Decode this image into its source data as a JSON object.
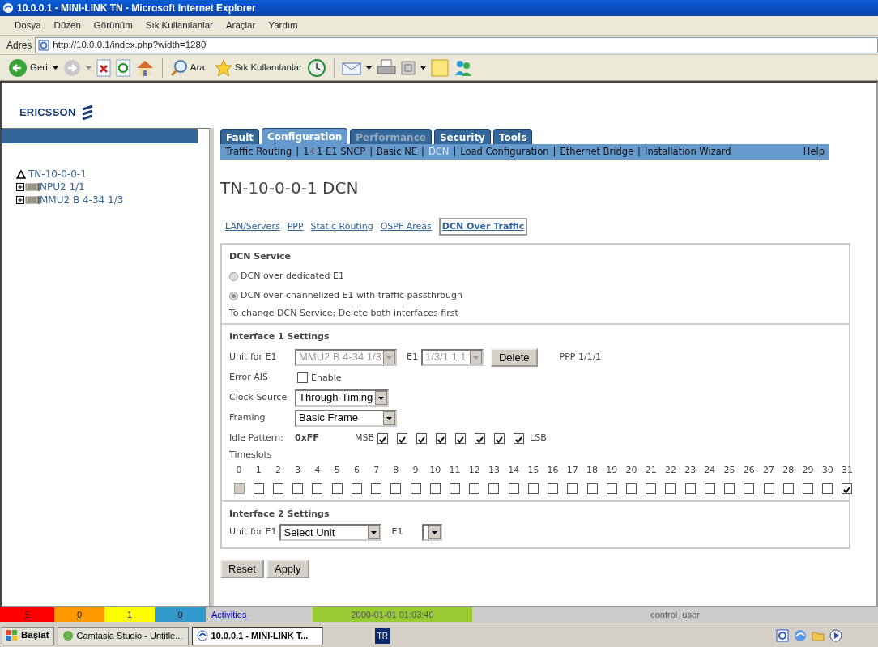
{
  "window": {
    "title": "10.0.0.1 - MINI-LINK TN - Microsoft Internet Explorer"
  },
  "menu_bar": [
    "Dosya",
    "Düzen",
    "Görünüm",
    "Sık Kullanılanlar",
    "Araçlar",
    "Yardım"
  ],
  "address_bar": {
    "label": "Adres",
    "url": "http://10.0.0.1/index.php?width=1280"
  },
  "toolbar": {
    "back_label": "Geri",
    "search_label": "Ara",
    "favorites_label": "Sık Kullanılanlar"
  },
  "logo": {
    "text": "ERICSSON"
  },
  "tree": {
    "label": "TN-10-0-0-1",
    "children": [
      {
        "label": "NPU2 1/1",
        "expanded": false
      },
      {
        "label": "MMU2 B 4-34 1/3",
        "expanded": false
      }
    ]
  },
  "tabs": [
    {
      "label": "Fault",
      "selected": false,
      "disabled": false
    },
    {
      "label": "Configuration",
      "selected": true,
      "disabled": false
    },
    {
      "label": "Performance",
      "selected": false,
      "disabled": true
    },
    {
      "label": "Security",
      "selected": false,
      "disabled": false
    },
    {
      "label": "Tools",
      "selected": false,
      "disabled": false
    }
  ],
  "subnav": {
    "items": [
      {
        "label": "Traffic Routing",
        "selected": false
      },
      {
        "label": "1+1 E1 SNCP",
        "selected": false
      },
      {
        "label": "Basic NE",
        "selected": false
      },
      {
        "label": "DCN",
        "selected": true
      },
      {
        "label": "Load Configuration",
        "selected": false
      },
      {
        "label": "Ethernet Bridge",
        "selected": false
      },
      {
        "label": "Installation Wizard",
        "selected": false
      }
    ],
    "separator": "|",
    "help": "Help"
  },
  "heading": "TN-10-0-0-1 DCN",
  "subtabs": [
    {
      "label": "LAN/Servers",
      "selected": false
    },
    {
      "label": "PPP",
      "selected": false
    },
    {
      "label": "Static Routing",
      "selected": false
    },
    {
      "label": "OSPF Areas",
      "selected": false
    },
    {
      "label": "DCN Over Traffic",
      "selected": true
    }
  ],
  "dcn_service": {
    "title": "DCN Service",
    "options": [
      {
        "label": "DCN over dedicated E1",
        "selected": false,
        "disabled": true
      },
      {
        "label": "DCN over channelized E1 with traffic passthrough",
        "selected": true,
        "disabled": true
      }
    ],
    "note": "To change DCN Service: Delete both interfaces first"
  },
  "interface_1": {
    "title": "Interface 1 Settings",
    "unit_label": "Unit for E1",
    "unit_value": "MMU2 B 4-34 1/3",
    "unit_disabled": true,
    "e1_label": "E1",
    "e1_value": "1/3/1 1.1",
    "e1_disabled": true,
    "delete_button": "Delete",
    "ppp": "PPP 1/1/1",
    "error_ais_label": "Error AIS",
    "error_ais": {
      "label": "Enable",
      "checked": false
    },
    "clock_label": "Clock Source",
    "clock_value": "Through-Timing",
    "framing_label": "Framing",
    "framing_value": "Basic Frame",
    "idle_label": "Idle Pattern:",
    "idle_value": "0xFF",
    "msb": "MSB",
    "lsb": "LSB",
    "idle_bits": [
      {
        "checked": true
      },
      {
        "checked": true
      },
      {
        "checked": true
      },
      {
        "checked": true
      },
      {
        "checked": true
      },
      {
        "checked": true
      },
      {
        "checked": true
      },
      {
        "checked": true
      }
    ],
    "timeslots_label": "Timeslots",
    "timeslots": [
      {
        "number": "0",
        "checked": false,
        "disabled": true
      },
      {
        "number": "1",
        "checked": false,
        "disabled": false
      },
      {
        "number": "2",
        "checked": false,
        "disabled": false
      },
      {
        "number": "3",
        "checked": false,
        "disabled": false
      },
      {
        "number": "4",
        "checked": false,
        "disabled": false
      },
      {
        "number": "5",
        "checked": false,
        "disabled": false
      },
      {
        "number": "6",
        "checked": false,
        "disabled": false
      },
      {
        "number": "7",
        "checked": false,
        "disabled": false
      },
      {
        "number": "8",
        "checked": false,
        "disabled": false
      },
      {
        "number": "9",
        "checked": false,
        "disabled": false
      },
      {
        "number": "10",
        "checked": false,
        "disabled": false
      },
      {
        "number": "11",
        "checked": false,
        "disabled": false
      },
      {
        "number": "12",
        "checked": false,
        "disabled": false
      },
      {
        "number": "13",
        "checked": false,
        "disabled": false
      },
      {
        "number": "14",
        "checked": false,
        "disabled": false
      },
      {
        "number": "15",
        "checked": false,
        "disabled": false
      },
      {
        "number": "16",
        "checked": false,
        "disabled": false
      },
      {
        "number": "17",
        "checked": false,
        "disabled": false
      },
      {
        "number": "18",
        "checked": false,
        "disabled": false
      },
      {
        "number": "19",
        "checked": false,
        "disabled": false
      },
      {
        "number": "20",
        "checked": false,
        "disabled": false
      },
      {
        "number": "21",
        "checked": false,
        "disabled": false
      },
      {
        "number": "22",
        "checked": false,
        "disabled": false
      },
      {
        "number": "23",
        "checked": false,
        "disabled": false
      },
      {
        "number": "24",
        "checked": false,
        "disabled": false
      },
      {
        "number": "25",
        "checked": false,
        "disabled": false
      },
      {
        "number": "26",
        "checked": false,
        "disabled": false
      },
      {
        "number": "27",
        "checked": false,
        "disabled": false
      },
      {
        "number": "28",
        "checked": false,
        "disabled": false
      },
      {
        "number": "29",
        "checked": false,
        "disabled": false
      },
      {
        "number": "30",
        "checked": false,
        "disabled": false
      },
      {
        "number": "31",
        "checked": true,
        "disabled": false
      }
    ]
  },
  "interface_2": {
    "title": "Interface 2 Settings",
    "unit_label": "Unit for E1",
    "unit_value": "Select Unit",
    "e1_label": "E1"
  },
  "buttons": [
    "Reset",
    "Apply"
  ],
  "status_bar": {
    "alarms": [
      {
        "count": "5",
        "color": "#ff0000"
      },
      {
        "count": "0",
        "color": "#ff9900"
      },
      {
        "count": "1",
        "color": "#ffff00"
      },
      {
        "count": "0",
        "color": "#3399cc"
      }
    ],
    "activities": "Activities",
    "time": "2000-01-01 01:03:40",
    "user": "control_user"
  },
  "taskbar": {
    "start": "Başlat",
    "tasks": [
      {
        "label": "Camtasia Studio - Untitle...",
        "selected": false
      },
      {
        "label": "10.0.0.1 - MINI-LINK T...",
        "selected": true
      }
    ],
    "language": "TR"
  }
}
